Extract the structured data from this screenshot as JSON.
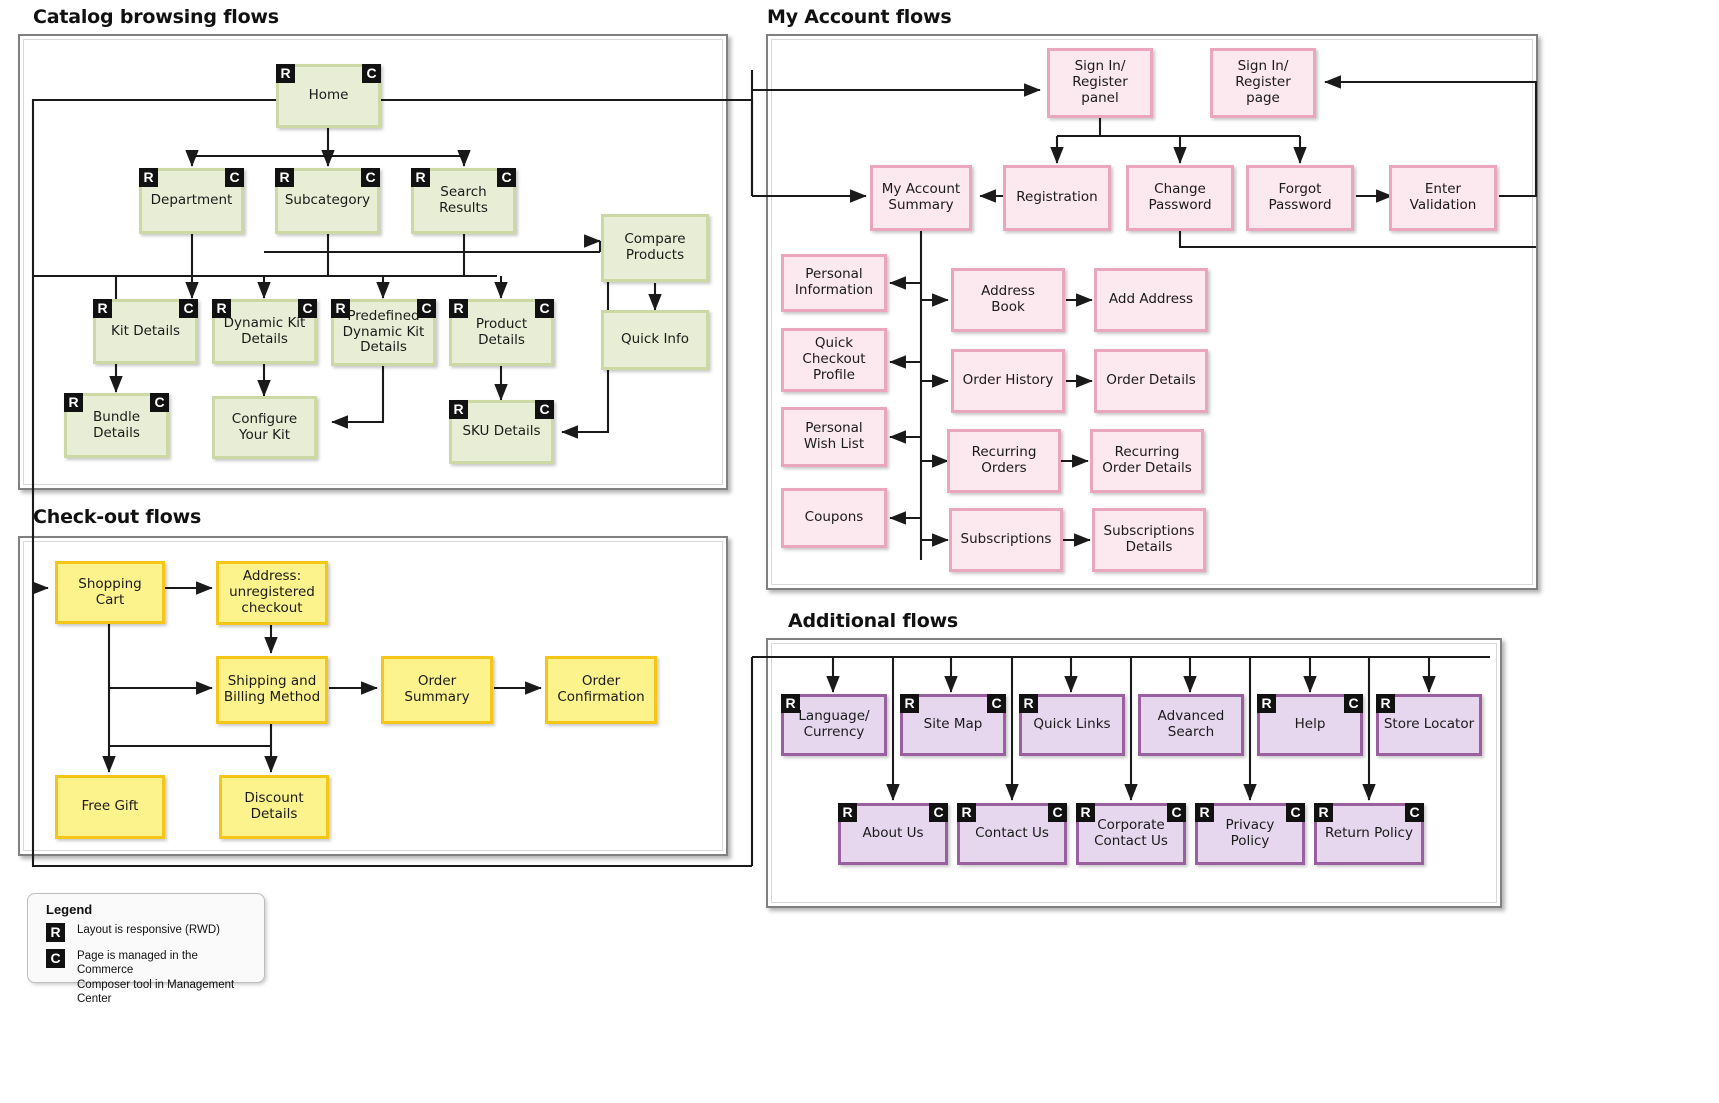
{
  "sections": {
    "catalog": {
      "title": "Catalog browsing flows",
      "nodes": [
        {
          "id": "home",
          "label": "Home",
          "r": true,
          "c": true
        },
        {
          "id": "department",
          "label": "Department",
          "r": true,
          "c": true
        },
        {
          "id": "subcategory",
          "label": "Subcategory",
          "r": true,
          "c": true
        },
        {
          "id": "search_results",
          "label": "Search\nResults",
          "r": true,
          "c": true
        },
        {
          "id": "compare_products",
          "label": "Compare\nProducts",
          "r": false,
          "c": false
        },
        {
          "id": "quick_info",
          "label": "Quick Info",
          "r": false,
          "c": false
        },
        {
          "id": "kit_details",
          "label": "Kit Details",
          "r": true,
          "c": true
        },
        {
          "id": "dynamic_kit_details",
          "label": "Dynamic Kit\nDetails",
          "r": true,
          "c": true
        },
        {
          "id": "predefined_dynamic_kit_details",
          "label": "Predefined\nDynamic Kit\nDetails",
          "r": true,
          "c": true
        },
        {
          "id": "product_details",
          "label": "Product\nDetails",
          "r": true,
          "c": true
        },
        {
          "id": "bundle_details",
          "label": "Bundle\nDetails",
          "r": true,
          "c": true
        },
        {
          "id": "configure_your_kit",
          "label": "Configure\nYour Kit",
          "r": false,
          "c": false
        },
        {
          "id": "sku_details",
          "label": "SKU Details",
          "r": true,
          "c": true
        }
      ]
    },
    "checkout": {
      "title": "Check-out flows",
      "nodes": [
        {
          "id": "shopping_cart",
          "label": "Shopping\nCart",
          "r": false,
          "c": false
        },
        {
          "id": "address_unregistered",
          "label": "Address:\nunregistered\ncheckout",
          "r": false,
          "c": false
        },
        {
          "id": "shipping_billing",
          "label": "Shipping  and\nBilling Method",
          "r": false,
          "c": false
        },
        {
          "id": "order_summary",
          "label": "Order\nSummary",
          "r": false,
          "c": false
        },
        {
          "id": "order_confirmation",
          "label": "Order\nConfirmation",
          "r": false,
          "c": false
        },
        {
          "id": "free_gift",
          "label": "Free Gift",
          "r": false,
          "c": false
        },
        {
          "id": "discount_details",
          "label": "Discount\nDetails",
          "r": false,
          "c": false
        }
      ]
    },
    "myaccount": {
      "title": "My Account flows",
      "nodes": [
        {
          "id": "signin_panel",
          "label": "Sign In/\nRegister\npanel",
          "r": false,
          "c": false
        },
        {
          "id": "signin_page",
          "label": "Sign In/\nRegister\npage",
          "r": false,
          "c": false
        },
        {
          "id": "my_account_summary",
          "label": "My Account\nSummary",
          "r": false,
          "c": false
        },
        {
          "id": "registration",
          "label": "Registration",
          "r": false,
          "c": false
        },
        {
          "id": "change_password",
          "label": "Change\nPassword",
          "r": false,
          "c": false
        },
        {
          "id": "forgot_password",
          "label": "Forgot\nPassword",
          "r": false,
          "c": false
        },
        {
          "id": "enter_validation",
          "label": "Enter\nValidation",
          "r": false,
          "c": false
        },
        {
          "id": "personal_information",
          "label": "Personal\nInformation",
          "r": false,
          "c": false
        },
        {
          "id": "quick_checkout_profile",
          "label": "Quick\nCheckout\nProfile",
          "r": false,
          "c": false
        },
        {
          "id": "personal_wish_list",
          "label": "Personal\nWish List",
          "r": false,
          "c": false
        },
        {
          "id": "coupons",
          "label": "Coupons",
          "r": false,
          "c": false
        },
        {
          "id": "address_book",
          "label": "Address\nBook",
          "r": false,
          "c": false
        },
        {
          "id": "add_address",
          "label": "Add Address",
          "r": false,
          "c": false
        },
        {
          "id": "order_history",
          "label": "Order History",
          "r": false,
          "c": false
        },
        {
          "id": "order_details",
          "label": "Order Details",
          "r": false,
          "c": false
        },
        {
          "id": "recurring_orders",
          "label": "Recurring\nOrders",
          "r": false,
          "c": false
        },
        {
          "id": "recurring_order_details",
          "label": "Recurring\nOrder Details",
          "r": false,
          "c": false
        },
        {
          "id": "subscriptions",
          "label": "Subscriptions",
          "r": false,
          "c": false
        },
        {
          "id": "subscriptions_details",
          "label": "Subscriptions\nDetails",
          "r": false,
          "c": false
        }
      ]
    },
    "additional": {
      "title": "Additional flows",
      "nodes": [
        {
          "id": "language_currency",
          "label": "Language/\nCurrency",
          "r": true,
          "c": false
        },
        {
          "id": "site_map",
          "label": "Site Map",
          "r": true,
          "c": true
        },
        {
          "id": "quick_links",
          "label": "Quick Links",
          "r": true,
          "c": false
        },
        {
          "id": "advanced_search",
          "label": "Advanced\nSearch",
          "r": false,
          "c": false
        },
        {
          "id": "help",
          "label": "Help",
          "r": true,
          "c": true
        },
        {
          "id": "store_locator",
          "label": "Store Locator",
          "r": true,
          "c": false
        },
        {
          "id": "about_us",
          "label": "About  Us",
          "r": true,
          "c": true
        },
        {
          "id": "contact_us",
          "label": "Contact Us",
          "r": true,
          "c": true
        },
        {
          "id": "corporate_contact_us",
          "label": "Corporate\nContact Us",
          "r": true,
          "c": true
        },
        {
          "id": "privacy_policy",
          "label": "Privacy\nPolicy",
          "r": true,
          "c": true
        },
        {
          "id": "return_policy",
          "label": "Return Policy",
          "r": true,
          "c": true
        }
      ]
    }
  },
  "legend": {
    "title": "Legend",
    "items": [
      {
        "badge": "R",
        "text": "Layout is responsive (RWD)"
      },
      {
        "badge": "C",
        "text": "Page is managed in the Commerce\nComposer tool in Management Center"
      }
    ]
  },
  "colors": {
    "catalog_fill": "#e8eed6",
    "catalog_border": "#cdd9a4",
    "myaccount_fill": "#fce8ef",
    "myaccount_border": "#eba6bf",
    "checkout_fill": "#fdf38c",
    "checkout_border": "#f5c518",
    "additional_fill": "#e6d7ef",
    "additional_border": "#9a5f9e",
    "panel_border": "#808080",
    "connector": "#1a1a1a",
    "badge_bg": "#111111"
  }
}
